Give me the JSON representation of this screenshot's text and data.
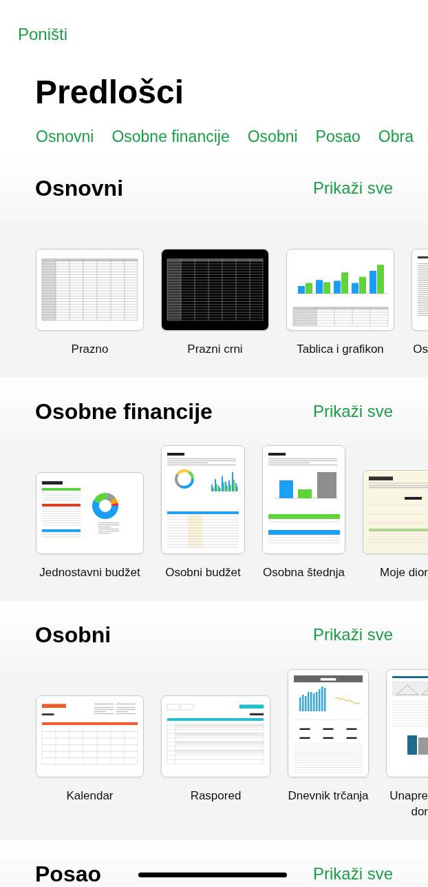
{
  "cancel": "Poništi",
  "title": "Predlošci",
  "categories": [
    "Osnovni",
    "Osobne financije",
    "Osobni",
    "Posao",
    "Obra"
  ],
  "sections": [
    {
      "title": "Osnovni",
      "show_all": "Prikaži sve",
      "templates": [
        {
          "label": "Prazno",
          "thumb": {
            "kind": "grid-light"
          }
        },
        {
          "label": "Prazni crni",
          "thumb": {
            "kind": "grid-dark"
          }
        },
        {
          "label": "Tablica i grafikon",
          "thumb": {
            "kind": "chart-table"
          }
        },
        {
          "label": "Os",
          "thumb": {
            "kind": "doc"
          }
        }
      ]
    },
    {
      "title": "Osobne financije",
      "show_all": "Prikaži sve",
      "templates": [
        {
          "label": "Jednostavni budžet",
          "thumb": {
            "kind": "budget"
          }
        },
        {
          "label": "Osobni budžet",
          "thumb": {
            "kind": "monthly-budget"
          }
        },
        {
          "label": "Osobna štednja",
          "thumb": {
            "kind": "monthly-goal"
          }
        },
        {
          "label": "Moje dior",
          "thumb": {
            "kind": "portfolio"
          }
        }
      ]
    },
    {
      "title": "Osobni",
      "show_all": "Prikaži sve",
      "templates": [
        {
          "label": "Kalendar",
          "thumb": {
            "kind": "calendar"
          }
        },
        {
          "label": "Raspored",
          "thumb": {
            "kind": "schedule"
          }
        },
        {
          "label": "Dnevnik trčanja",
          "thumb": {
            "kind": "running-log"
          }
        },
        {
          "label": "Unapre\ndor",
          "thumb": {
            "kind": "remodel"
          }
        }
      ]
    },
    {
      "title": "Posao",
      "show_all": "Prikaži sve"
    }
  ]
}
